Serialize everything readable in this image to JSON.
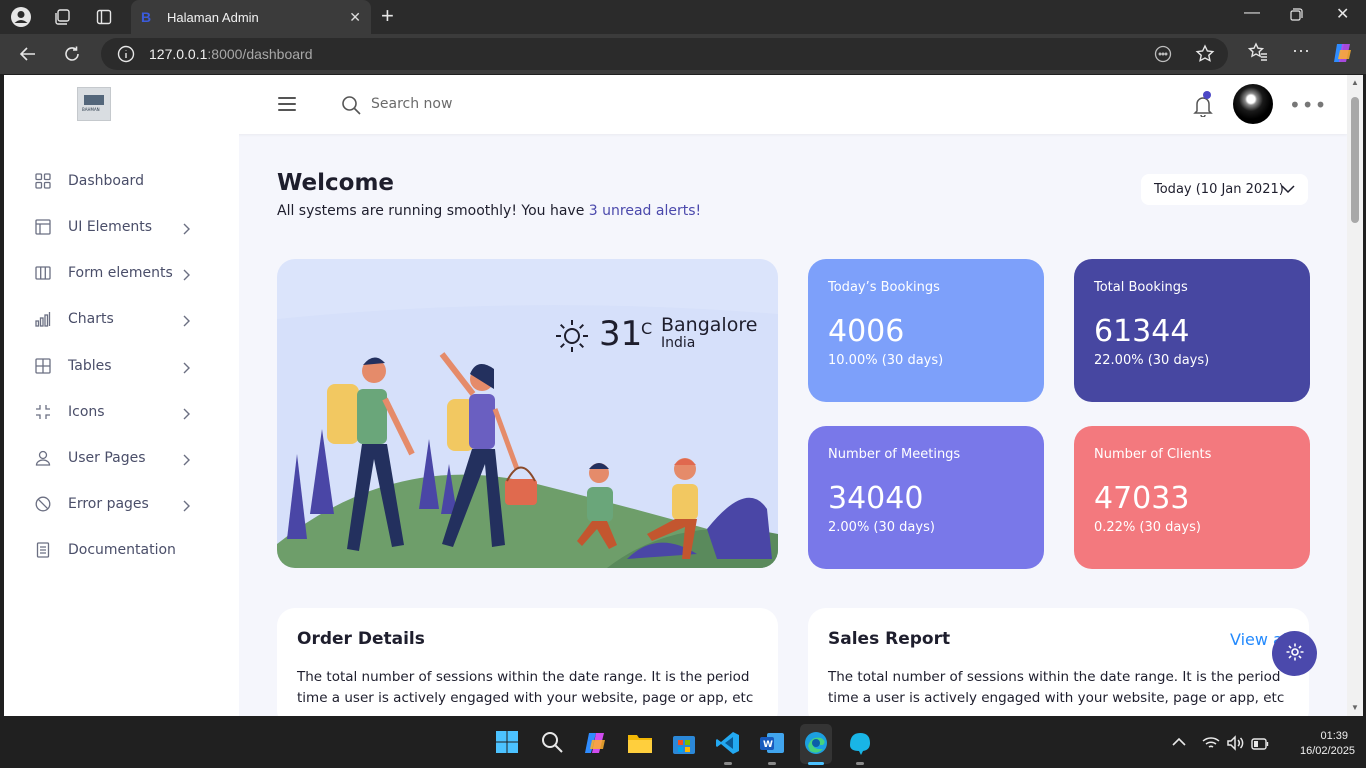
{
  "browser": {
    "tab_title": "Halaman Admin",
    "tab_favicon": "B",
    "url_host": "127.0.0.1",
    "url_path": ":8000/dashboard"
  },
  "header": {
    "search_placeholder": "Search now",
    "notification_dot_color": "#4c48c6"
  },
  "logo_text": "BAHMAN",
  "sidebar": {
    "items": [
      {
        "label": "Dashboard",
        "icon": "grid-icon",
        "has_submenu": false
      },
      {
        "label": "UI Elements",
        "icon": "layout-icon",
        "has_submenu": true
      },
      {
        "label": "Form elements",
        "icon": "columns-icon",
        "has_submenu": true
      },
      {
        "label": "Charts",
        "icon": "bar-chart-icon",
        "has_submenu": true
      },
      {
        "label": "Tables",
        "icon": "table-icon",
        "has_submenu": true
      },
      {
        "label": "Icons",
        "icon": "minimize-icon",
        "has_submenu": true
      },
      {
        "label": "User Pages",
        "icon": "user-icon",
        "has_submenu": true
      },
      {
        "label": "Error pages",
        "icon": "ban-icon",
        "has_submenu": true
      },
      {
        "label": "Documentation",
        "icon": "document-icon",
        "has_submenu": false
      }
    ]
  },
  "main": {
    "welcome_title": "Welcome",
    "welcome_text": "All systems are running smoothly! You have ",
    "alert_link": "3 unread alerts!",
    "date_label": "Today (10 Jan 2021)",
    "weather": {
      "temperature": "31",
      "unit": "C",
      "city": "Bangalore",
      "country": "India"
    },
    "stats": [
      {
        "title": "Today’s Bookings",
        "value": "4006",
        "change": "10.00% (30 days)",
        "color": "#7da0fa"
      },
      {
        "title": "Total Bookings",
        "value": "61344",
        "change": "22.00% (30 days)",
        "color": "#4747a1"
      },
      {
        "title": "Number of Meetings",
        "value": "34040",
        "change": "2.00% (30 days)",
        "color": "#7978e9"
      },
      {
        "title": "Number of Clients",
        "value": "47033",
        "change": "0.22% (30 days)",
        "color": "#f3797e"
      }
    ],
    "order_details": {
      "title": "Order Details",
      "text": "The total number of sessions within the date range. It is the period time a user is actively engaged with your website, page or app, etc"
    },
    "sales_report": {
      "title": "Sales Report",
      "link": "View all",
      "text": "The total number of sessions within the date range. It is the period time a user is actively engaged with your website, page or app, etc"
    }
  },
  "taskbar": {
    "time": "01:39",
    "date": "16/02/2025"
  },
  "colors": {
    "accent": "#4b49ac",
    "page_bg": "#f5f6fc",
    "link": "#248afd"
  }
}
